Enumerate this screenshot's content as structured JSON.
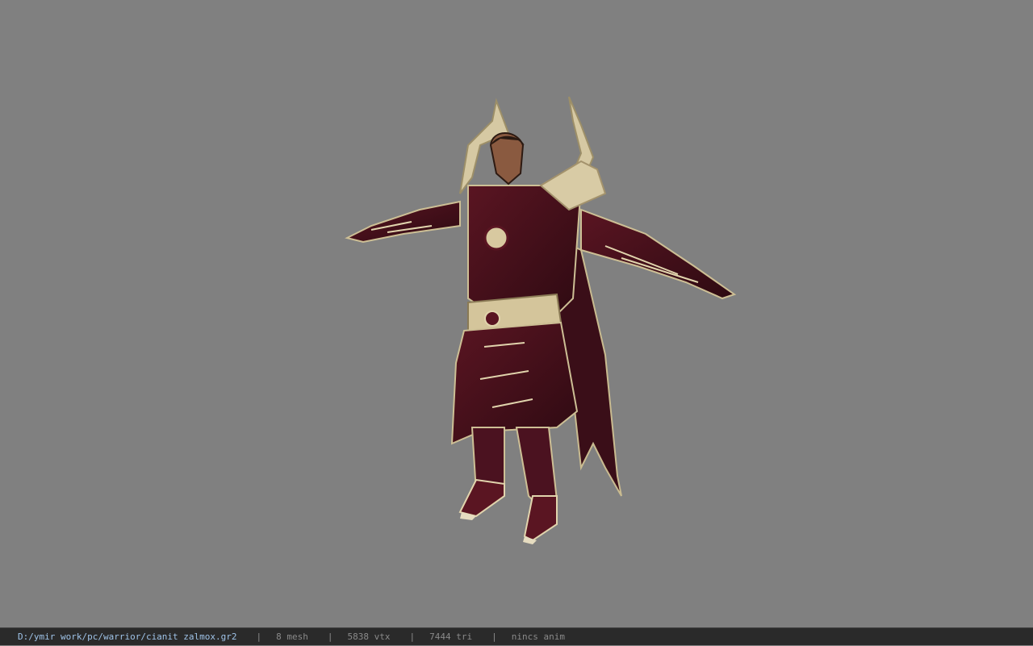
{
  "viewport": {
    "background_color": "#808080",
    "model_subject": "armored-warrior-character-tpose"
  },
  "status_bar": {
    "file_path": "D:/ymir work/pc/warrior/cianit zalmox.gr2",
    "separator": "|",
    "mesh_count": "8 mesh",
    "vertex_count": "5838 vtx",
    "triangle_count": "7444 tri",
    "anim_status": "nincs anim",
    "path_color": "#9fc3e8",
    "stat_color": "#8a8a8a"
  }
}
